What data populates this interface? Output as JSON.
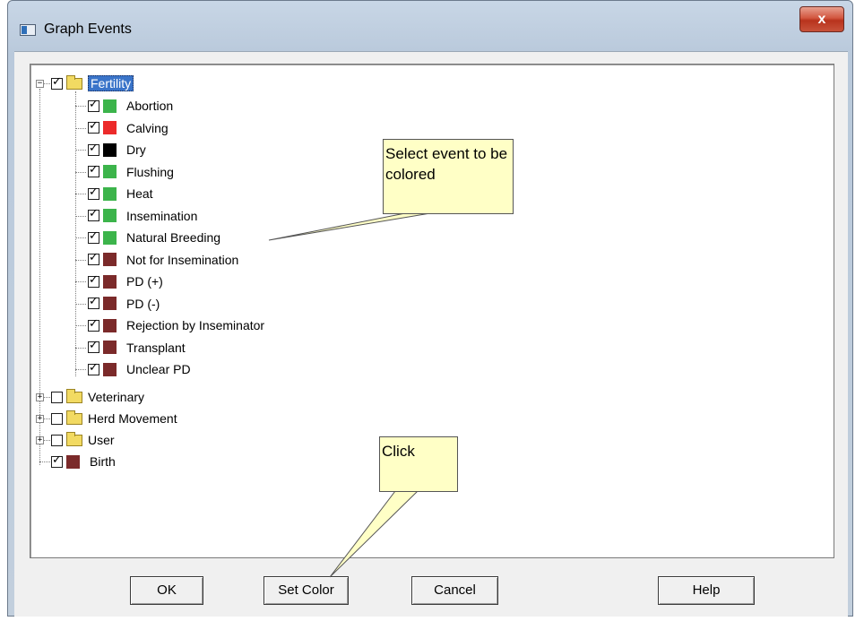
{
  "window": {
    "title": "Graph Events",
    "close_glyph": "x"
  },
  "tree": {
    "root": {
      "label": "Fertility",
      "checked": true,
      "expanded": true
    },
    "fertility_items": [
      {
        "label": "Abortion",
        "color": "#3cb44b",
        "checked": true
      },
      {
        "label": "Calving",
        "color": "#ec2a2a",
        "checked": true
      },
      {
        "label": "Dry",
        "color": "#000000",
        "checked": true
      },
      {
        "label": "Flushing",
        "color": "#3cb44b",
        "checked": true
      },
      {
        "label": "Heat",
        "color": "#3cb44b",
        "checked": true
      },
      {
        "label": "Insemination",
        "color": "#3cb44b",
        "checked": true
      },
      {
        "label": "Natural Breeding",
        "color": "#3cb44b",
        "checked": true
      },
      {
        "label": "Not for Insemination",
        "color": "#7b2a2a",
        "checked": true
      },
      {
        "label": "PD (+)",
        "color": "#7b2a2a",
        "checked": true
      },
      {
        "label": "PD (-)",
        "color": "#7b2a2a",
        "checked": true
      },
      {
        "label": "Rejection by Inseminator",
        "color": "#7b2a2a",
        "checked": true
      },
      {
        "label": "Transplant",
        "color": "#7b2a2a",
        "checked": true
      },
      {
        "label": "Unclear PD",
        "color": "#7b2a2a",
        "checked": true
      }
    ],
    "other_groups": [
      {
        "label": "Veterinary",
        "checked": false
      },
      {
        "label": "Herd Movement",
        "checked": false
      },
      {
        "label": "User",
        "checked": false
      }
    ],
    "birth": {
      "label": "Birth",
      "color": "#7b2a2a",
      "checked": true
    }
  },
  "callouts": {
    "select_event": "Select event to be colored",
    "click": "Click"
  },
  "buttons": {
    "ok": "OK",
    "set_color": "Set Color",
    "cancel": "Cancel",
    "help": "Help"
  }
}
